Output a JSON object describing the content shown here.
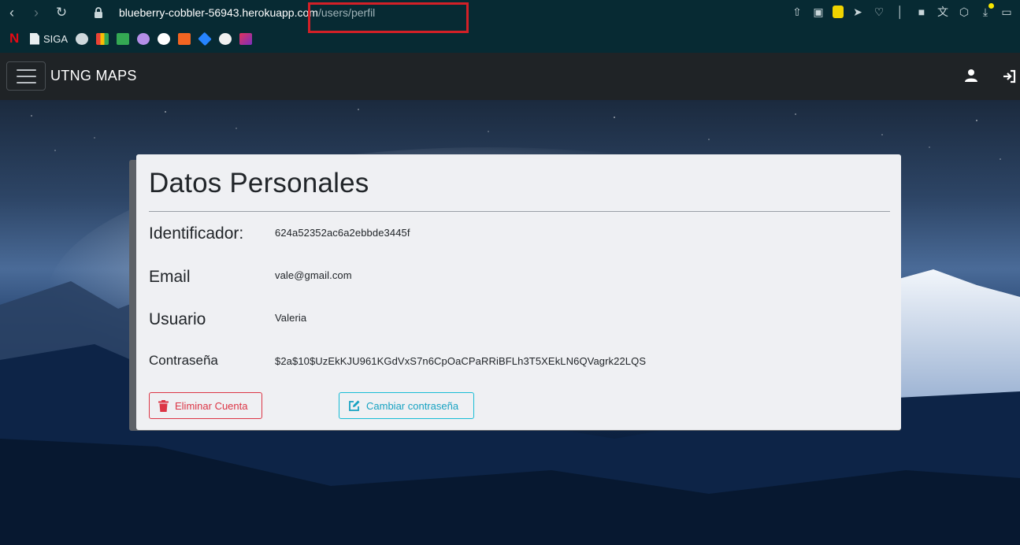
{
  "browser": {
    "url_host": "blueberry-cobbler-56943.herokuapp.com",
    "url_path": "/users/perfil",
    "bookmarks": [
      "N",
      "SIGA"
    ]
  },
  "navbar": {
    "brand": "UTNG MAPS"
  },
  "profile": {
    "title": "Datos Personales",
    "fields": [
      {
        "label": "Identificador:",
        "value": "624a52352ac6a2ebbde3445f"
      },
      {
        "label": "Email",
        "value": "vale@gmail.com"
      },
      {
        "label": "Usuario",
        "value": "Valeria"
      },
      {
        "label": "Contraseña",
        "value": "$2a$10$UzEkKJU961KGdVxS7n6CpOaCPaRRiBFLh3T5XEkLN6QVagrk22LQS"
      }
    ],
    "delete_label": "Eliminar Cuenta",
    "change_password_label": "Cambiar contraseña"
  },
  "colors": {
    "danger": "#dc3545",
    "info": "#17bcd6",
    "navbar": "#1f2326",
    "browser": "#072a33",
    "highlight": "#d32027"
  },
  "icons": [
    "back-icon",
    "forward-icon",
    "reload-icon",
    "lock-icon",
    "user-icon",
    "login-icon",
    "trash-icon",
    "edit-icon"
  ]
}
